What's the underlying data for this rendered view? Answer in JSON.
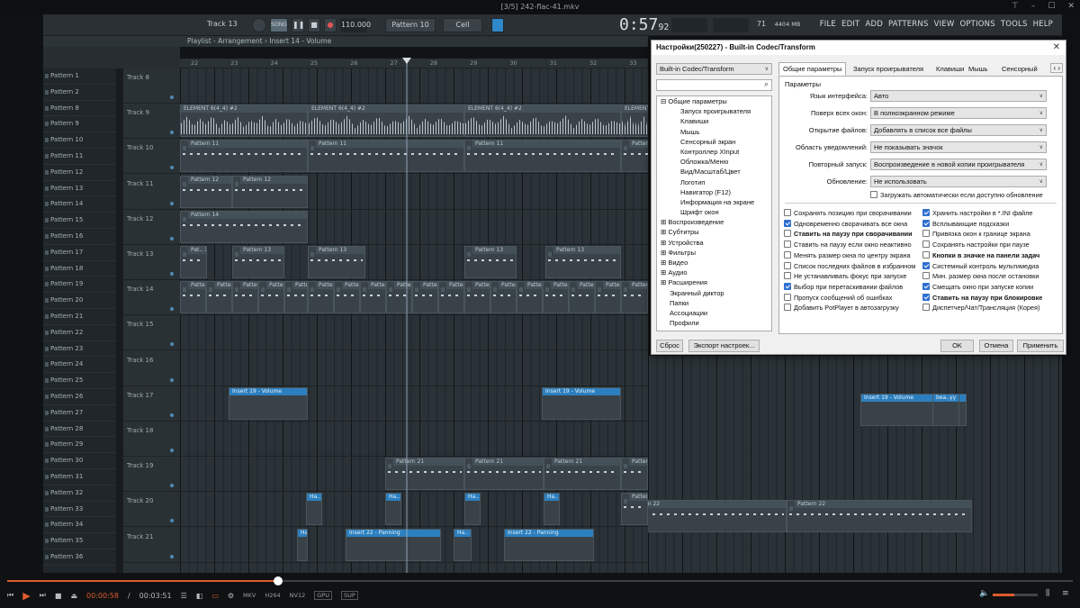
{
  "window": {
    "title": "[3/5] 242-flac-41.mkv"
  },
  "fl": {
    "menu": [
      "FILE",
      "EDIT",
      "ADD",
      "PATTERNS",
      "VIEW",
      "OPTIONS",
      "TOOLS",
      "HELP"
    ],
    "track_label": "Track 13",
    "song_badge": "SONG",
    "tempo": "110.000",
    "pattern": "Pattern 10",
    "cell": "Cell",
    "time": "0:57",
    "time_frac": "92",
    "cpu": "71",
    "mem": "4404 MB",
    "voices": "16"
  },
  "playlist": {
    "breadcrumb": "Playlist - Arrangement › Insert 14 - Volume",
    "ruler": [
      "22",
      "23",
      "24",
      "25",
      "26",
      "27",
      "28",
      "29",
      "30",
      "31",
      "32",
      "33"
    ]
  },
  "patterns": [
    "Pattern 1",
    "Pattern 2",
    "Pattern 8",
    "Pattern 9",
    "Pattern 10",
    "Pattern 11",
    "Pattern 12",
    "Pattern 13",
    "Pattern 14",
    "Pattern 15",
    "Pattern 16",
    "Pattern 17",
    "Pattern 18",
    "Pattern 19",
    "Pattern 20",
    "Pattern 21",
    "Pattern 22",
    "Pattern 23",
    "Pattern 24",
    "Pattern 25",
    "Pattern 26",
    "Pattern 27",
    "Pattern 28",
    "Pattern 29",
    "Pattern 30",
    "Pattern 31",
    "Pattern 32",
    "Pattern 33",
    "Pattern 34",
    "Pattern 35",
    "Pattern 36"
  ],
  "tracks": [
    "Track 8",
    "Track 9",
    "Track 10",
    "Track 11",
    "Track 12",
    "Track 13",
    "Track 14",
    "Track 15",
    "Track 16",
    "Track 17",
    "Track 18",
    "Track 19",
    "Track 20",
    "Track 21"
  ],
  "clips": {
    "element": "ELEMENT 6(4_4) #2",
    "pattern11": "Pattern 11",
    "pattern12": "Pattern 12",
    "pattern14": "Pattern 14",
    "pattern13": "Pattern 13",
    "pattern13short": "Pat.. 13",
    "pattern15": "Pattern 15",
    "insert19": "Insert 19 - Volume",
    "pattern21": "Pattern 21",
    "pattern22": "Pattern 22",
    "insert22": "Insert 22 - Panning",
    "auto_short": "Ha..",
    "bass_short": "bea..yy"
  },
  "dialog": {
    "title": "Настройки(250227) - Built-in Codec/Transform",
    "close": "✕",
    "preset": "Built-in Codec/Transform",
    "search_placeholder": "",
    "tabs": [
      "Общие параметры",
      "Запуск проигрывателя",
      "Клавиши",
      "Мышь",
      "Сенсорный"
    ],
    "tree": [
      {
        "t": "⊟ Общие параметры",
        "lvl": 0
      },
      {
        "t": "Запуск проигрывателя",
        "lvl": 2
      },
      {
        "t": "Клавиши",
        "lvl": 2
      },
      {
        "t": "Мышь",
        "lvl": 2
      },
      {
        "t": "Сенсорный экран",
        "lvl": 2
      },
      {
        "t": "Контроллер XInput",
        "lvl": 2
      },
      {
        "t": "Обложка/Меню",
        "lvl": 2
      },
      {
        "t": "Вид/Масштаб/Цвет",
        "lvl": 2
      },
      {
        "t": "Логотип",
        "lvl": 2
      },
      {
        "t": "Навигатор (F12)",
        "lvl": 2
      },
      {
        "t": "Информация на экране",
        "lvl": 2
      },
      {
        "t": "Шрифт окон",
        "lvl": 2
      },
      {
        "t": "⊞ Воспроизведение",
        "lvl": 0
      },
      {
        "t": "⊞ Субтитры",
        "lvl": 0
      },
      {
        "t": "⊞ Устройства",
        "lvl": 0
      },
      {
        "t": "⊞ Фильтры",
        "lvl": 0
      },
      {
        "t": "⊞ Видео",
        "lvl": 0
      },
      {
        "t": "⊞ Аудио",
        "lvl": 0
      },
      {
        "t": "⊞ Расширения",
        "lvl": 0
      },
      {
        "t": "Экранный диктор",
        "lvl": 1
      },
      {
        "t": "Папки",
        "lvl": 1
      },
      {
        "t": "Ассоциации",
        "lvl": 1
      },
      {
        "t": "Профили",
        "lvl": 1
      }
    ],
    "group_title": "Параметры",
    "fields": [
      {
        "label": "Язык интерфейса:",
        "value": "Авто"
      },
      {
        "label": "Поверх всех окон:",
        "value": "В полноэкранном режиме"
      },
      {
        "label": "Открытие файлов:",
        "value": "Добавлять в список все файлы"
      },
      {
        "label": "Область уведомлений:",
        "value": "Не показывать значок"
      },
      {
        "label": "Повторный запуск:",
        "value": "Воспроизведение в новой копии проигрывателя"
      },
      {
        "label": "Обновление:",
        "value": "Не использовать"
      }
    ],
    "autoupdate": "Загружать автоматически если доступно обновление",
    "checks_left": [
      {
        "t": "Сохранять позицию при сворачивании",
        "on": false,
        "b": false
      },
      {
        "t": "Одновременно сворачивать все окна",
        "on": true,
        "b": false
      },
      {
        "t": "Ставить на паузу при сворачивании",
        "on": false,
        "b": true
      },
      {
        "t": "Ставить на паузу если окно неактивно",
        "on": false,
        "b": false
      },
      {
        "t": "Менять размер окна по центру экрана",
        "on": false,
        "b": false
      },
      {
        "t": "Список последних файлов в избранном",
        "on": false,
        "b": false
      },
      {
        "t": "Не устанавливать фокус при запуске",
        "on": false,
        "b": false
      },
      {
        "t": "Выбор при перетаскивании файлов",
        "on": true,
        "b": false
      },
      {
        "t": "Пропуск сообщений об ошибках",
        "on": false,
        "b": false
      },
      {
        "t": "Добавить PotPlayer в автозагрузку",
        "on": false,
        "b": false
      }
    ],
    "checks_right": [
      {
        "t": "Хранить настройки в *.INI файле",
        "on": true,
        "b": false
      },
      {
        "t": "Всплывающие подсказки",
        "on": true,
        "b": false
      },
      {
        "t": "Привязка окон к границе экрана",
        "on": false,
        "b": false
      },
      {
        "t": "Сохранять настройки при паузе",
        "on": false,
        "b": false
      },
      {
        "t": "Кнопки в значке на панели задач",
        "on": false,
        "b": true
      },
      {
        "t": "Системный контроль мультимедиа",
        "on": true,
        "b": false
      },
      {
        "t": "Мин. размер окна после остановки",
        "on": false,
        "b": false
      },
      {
        "t": "Смещать окно при запуске копии",
        "on": true,
        "b": false
      },
      {
        "t": "Ставить на паузу при блокировке",
        "on": true,
        "b": true
      },
      {
        "t": "Диспетчер/Чат/Трансляция (Корея)",
        "on": false,
        "b": false
      }
    ],
    "btn_reset": "Сброс",
    "btn_export": "Экспорт настроек...",
    "btn_ok": "OK",
    "btn_cancel": "Отмена",
    "btn_apply": "Применить"
  },
  "player": {
    "current": "00:00:58",
    "total": "00:03:51",
    "tags": [
      "MKV",
      "H264",
      "NV12",
      "GPU",
      "SUP"
    ],
    "progress": 0.25
  },
  "colors": {
    "accent": "#e05a2e",
    "fl_auto": "#2c7fbf",
    "checkbox": "#2f6fd1"
  }
}
